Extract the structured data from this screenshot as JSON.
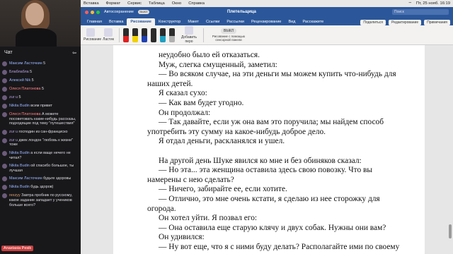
{
  "chat": {
    "header": "Чат",
    "messages": [
      {
        "user": "Максим Ласточкин",
        "text": "5"
      },
      {
        "user": "Блаблабла",
        "text": "5"
      },
      {
        "user": "Алексей Nik",
        "text": "5"
      },
      {
        "user": "Олеся Платонова",
        "text": "5"
      },
      {
        "user": "zur u",
        "text": "5"
      },
      {
        "user": "Nikita Budin",
        "text": "всем привет"
      },
      {
        "user": "Олеся Платонова",
        "text": "А можете посоветовать какие-нибудь рассказы, подходящие под тему \"путешествия\""
      },
      {
        "user": "zur u",
        "text": "господин из сан-франциско"
      },
      {
        "user": "zur u",
        "text": "джек лондон \"любовь к жизни\" тоже"
      },
      {
        "user": "Nikita Budin",
        "text": "а если ваще нечего не читал?"
      },
      {
        "user": "Nikita Budin",
        "text": "ой спасибо большое, ты лучшая"
      },
      {
        "user": "Максим Ласточкин",
        "text": "будьте здоровы"
      },
      {
        "user": "Nikita Budin",
        "text": "будь здоров)"
      },
      {
        "user": "rexzyy",
        "text": "Завтра пробник по русскому, какое задание западает у учеников больше всего?"
      }
    ],
    "viewer_badge": "Anastasia Pesik"
  },
  "menubar": {
    "items": [
      "Вставка",
      "Формат",
      "Сервис",
      "Таблица",
      "Окно",
      "Справка"
    ],
    "clock": "Пт, 25 нояб. 16:19"
  },
  "titlebar": {
    "autosave": "Автосохранение",
    "toggle": "ВЫКЛ",
    "document": "Плетельщица",
    "search": "Поиск"
  },
  "tabs": {
    "items": [
      "Главная",
      "Вставка",
      "Рисование",
      "Конструктор",
      "Макет",
      "Ссылки",
      "Рассылки",
      "Рецензирование",
      "Вид",
      "Расскажите"
    ],
    "active_index": 2,
    "share": "Поделиться",
    "editing": "Редактирование",
    "comments": "Примечания"
  },
  "ribbon": {
    "draw": "Рисование",
    "eraser": "Ластик",
    "add_pen": "Добавить перо",
    "touch_draw": "Рисование с помощью сенсорной панели",
    "off": "ВЫКЛ"
  },
  "document": {
    "lines": [
      "неудобно было ей отказаться.",
      "Муж, слегка смущенный, заметил:",
      "— Во всяком случае, на эти деньги мы можем купить что-нибудь для",
      "наших детей.",
      "Я сказал сухо:",
      "— Как вам будет угодно.",
      "Он продолжал:",
      "— Так давайте, если уж она вам это поручила; мы найдем способ",
      "употребить эту сумму на какое-нибудь доброе дело.",
      "Я отдал деньги, раскланялся и ушел.",
      "",
      "На другой день Шуке явился ко мне и без обиняков сказал:",
      "— Но эта... эта женщина оставила здесь свою повозку. Что вы",
      "намерены с нею сделать?",
      "— Ничего, забирайте ее, если хотите.",
      "— Отлично, это мне очень кстати, я сделаю из нее сторожку для",
      "огорода.",
      "Он хотел уйти. Я позвал его:",
      "— Она оставила еще старую клячу и двух собак. Нужны они вам?",
      "Он удивился:",
      "— Ну вот еще, что я с ними буду делать? Располагайте ими по своему"
    ],
    "indented": [
      true,
      true,
      true,
      false,
      true,
      true,
      true,
      true,
      false,
      true,
      false,
      true,
      true,
      false,
      true,
      true,
      false,
      true,
      true,
      true,
      true
    ]
  }
}
